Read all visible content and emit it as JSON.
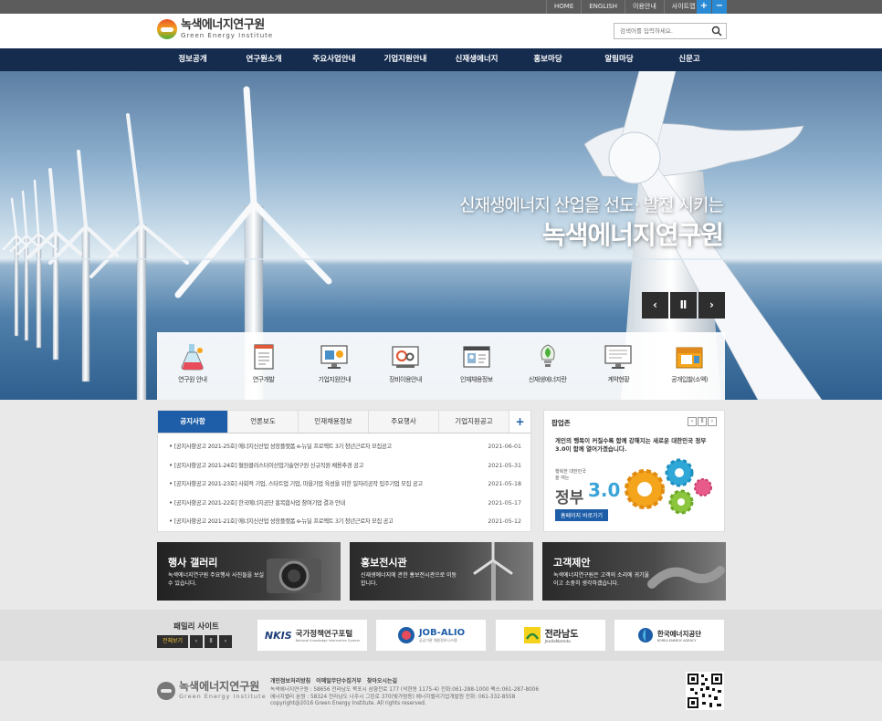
{
  "util": {
    "links": [
      "HOME",
      "ENGLISH",
      "이용안내",
      "사이트맵"
    ],
    "zoom_in": "+",
    "zoom_out": "−"
  },
  "header": {
    "logo_ko": "녹색에너지연구원",
    "logo_en": "Green Energy Institute",
    "search_placeholder": "검색어를 입력하세요."
  },
  "nav": [
    "정보공개",
    "연구원소개",
    "주요사업안내",
    "기업지원안내",
    "신재생에너지",
    "홍보마당",
    "알림마당",
    "신문고"
  ],
  "hero": {
    "line1": "신재생에너지 산업을 선도· 발전 시키는",
    "line2": "녹색에너지연구원",
    "prev": "‹",
    "pause": "Ⅱ",
    "next": "›"
  },
  "quick": [
    {
      "label": "연구원 안내",
      "icon": "flask-icon"
    },
    {
      "label": "연구개발",
      "icon": "document-icon"
    },
    {
      "label": "기업지원안내",
      "icon": "monitor-chart-icon"
    },
    {
      "label": "장비이용안내",
      "icon": "gear-device-icon"
    },
    {
      "label": "인재채용정보",
      "icon": "id-card-icon"
    },
    {
      "label": "신재생에너지란",
      "icon": "bulb-leaf-icon"
    },
    {
      "label": "계약현황",
      "icon": "contract-icon"
    },
    {
      "label": "공개입찰(소액)",
      "icon": "bid-box-icon"
    }
  ],
  "notice": {
    "tabs": [
      "공지사항",
      "언론보도",
      "인재채용정보",
      "주요행사",
      "기업지원공고"
    ],
    "plus": "+",
    "items": [
      {
        "title": "[공지사항공고 2021-25호] 에너지신산업 성장플랫폼 e-뉴딜 프로젝트 3기 청년근로자 모집공고",
        "date": "2021-06-01"
      },
      {
        "title": "[공지사항공고 2021-24호] 혈원클러스터이산업기술연구원 신규직원 채용추경 공고",
        "date": "2021-05-31"
      },
      {
        "title": "[공지사항공고 2021-23호] 사회적 기업, 스타트업 기업, 마을기업 육성을 위한 일자리공작 입주기업 모집 공고",
        "date": "2021-05-18"
      },
      {
        "title": "[공지사항공고 2021-22호] 한국에너지공단 홍복합사업 참여기업 결과 안내",
        "date": "2021-05-17"
      },
      {
        "title": "[공지사항공고 2021-21호] 에너지신산업 성장플랫폼 e-뉴딜 프로젝트 3기 청년근로자 모집 공고",
        "date": "2021-05-12"
      }
    ]
  },
  "popup": {
    "title": "팝업존",
    "ctrl": [
      "‹",
      "ll",
      "›"
    ],
    "headline": "개인의 행복이 커질수록 함께 강해지는 새로운 대한민국 정부3.0이 함께 열어가겠습니다.",
    "sub": "행복한 대한민국을 여는",
    "brand": "정부",
    "version": "3.0",
    "button": "홈페이지 바로가기"
  },
  "banners": [
    {
      "title": "행사 갤러리",
      "desc": "녹색에너지연구원 주요행사 사진들을 보실 수 있습니다."
    },
    {
      "title": "홍보전시관",
      "desc": "신재생에너지에 관한 홍보전시관으로 이동합니다."
    },
    {
      "title": "고객제안",
      "desc": "녹색에너지연구원은 고객의 소리에 귀기울이고 소중히 생각하겠습니다."
    }
  ],
  "family": {
    "title": "패밀리 사이트",
    "all": "전체보기",
    "prev": "‹",
    "pause": "ll",
    "next": "›",
    "sites": [
      {
        "name": "국가정책연구포털",
        "abbr": "NKIS",
        "sub": "National Knowledge Information System"
      },
      {
        "name": "JOB-ALIO",
        "sub": "공공기관 채용정보시스템"
      },
      {
        "name": "전라남도",
        "sub": "JeollaNamdo"
      },
      {
        "name": "한국에너지공단",
        "sub": "KOREA ENERGY AGENCY"
      }
    ]
  },
  "footer": {
    "logo_ko": "녹색에너지연구원",
    "logo_en": "Green Energy Institute",
    "links": [
      "개인정보처리방침",
      "이메일무단수집거부",
      "찾아오시는길"
    ],
    "addr1": "녹색에너지연구원 : 58656 전라남도 목포시 삼향천로 177 (석현동 1175-4) 전화:061-288-1000 팩스:061-287-8006",
    "addr2": "에너지밸리 분원 : 58324 전라남도 나주시 그린로 370(빛가람동) 에너지밸리기업개발원 전화: 061-332-8558",
    "copyright": "copyright@2016 Green Energy Institute. All rights reserved."
  },
  "colors": {
    "nav_bg": "#152c4f",
    "accent": "#1e5ea8",
    "util_bg": "#5c5c5c"
  }
}
